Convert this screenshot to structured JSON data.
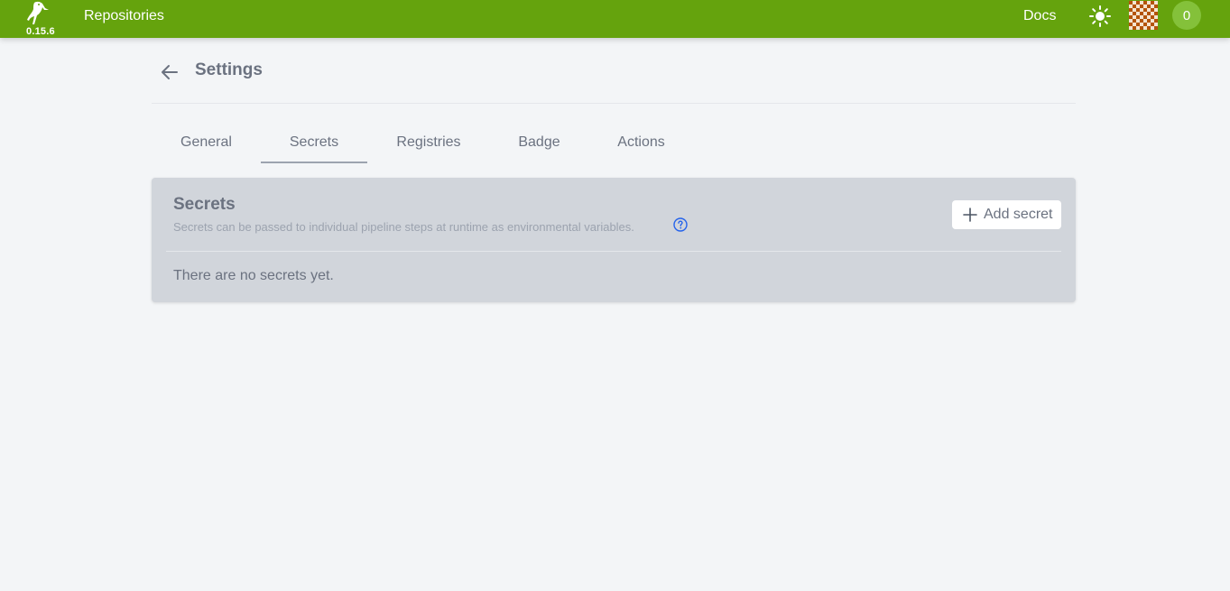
{
  "navbar": {
    "version": "0.15.6",
    "repositories_label": "Repositories",
    "docs_label": "Docs",
    "notification_count": "0",
    "brand_color": "#65a30d"
  },
  "header": {
    "title": "Settings"
  },
  "tabs": [
    {
      "label": "General",
      "active": false
    },
    {
      "label": "Secrets",
      "active": true
    },
    {
      "label": "Registries",
      "active": false
    },
    {
      "label": "Badge",
      "active": false
    },
    {
      "label": "Actions",
      "active": false
    }
  ],
  "secrets_panel": {
    "title": "Secrets",
    "description": "Secrets can be passed to individual pipeline steps at runtime as environmental variables.",
    "add_button_label": "Add secret",
    "empty_message": "There are no secrets yet."
  },
  "icons": {
    "back": "arrow-left-icon",
    "theme": "sun-icon",
    "help": "question-circle-icon",
    "add": "plus-icon"
  }
}
